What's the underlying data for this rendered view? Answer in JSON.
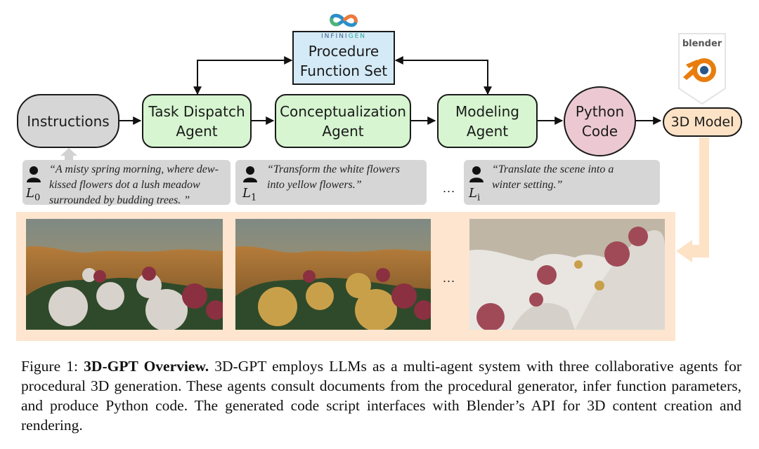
{
  "figure": {
    "logos": {
      "infinigen": {
        "label": "INFINIGEN",
        "label_highlight": "GEN",
        "label_main": "INFINI"
      },
      "blender": {
        "label": "blender"
      }
    },
    "nodes": {
      "procedure_function_set": {
        "line1": "Procedure",
        "line2": "Function Set"
      },
      "instructions": {
        "label": "Instructions"
      },
      "task_dispatch_agent": {
        "line1": "Task Dispatch",
        "line2": "Agent"
      },
      "conceptualization_agent": {
        "line1": "Conceptualization",
        "line2": "Agent"
      },
      "modeling_agent": {
        "line1": "Modeling",
        "line2": "Agent"
      },
      "python_code": {
        "line1": "Python",
        "line2": "Code"
      },
      "model_3d": {
        "label": "3D Model"
      }
    },
    "instructions": [
      {
        "var": "L",
        "sub": "0",
        "text": "“A misty spring morning, where dew-kissed flowers dot a lush meadow surrounded by budding trees. ”",
        "lines": [
          "“A misty spring morning, where dew-",
          "kissed flowers dot a lush meadow",
          "surrounded by budding trees. ”"
        ]
      },
      {
        "var": "L",
        "sub": "1",
        "text": "“Transform the white flowers into yellow flowers.”",
        "lines": [
          "“Transform the white flowers",
          "into yellow flowers.”"
        ]
      },
      {
        "var": "L",
        "sub": "i",
        "text": "“Translate the scene into a winter setting.”",
        "lines": [
          "“Translate the scene into a",
          "winter setting.”"
        ]
      }
    ],
    "ellipsis_instructions": "...",
    "ellipsis_renders": "...",
    "renders": [
      {
        "name": "spring-meadow-white-flowers"
      },
      {
        "name": "spring-meadow-yellow-flowers"
      },
      {
        "name": "winter-scene"
      }
    ],
    "colors": {
      "agent_fill": "#d6f5d0",
      "instructions_fill": "#d6d6d6",
      "procedure_fill": "#d4eaf7",
      "python_fill": "#ecc9d2",
      "model_fill": "#fde2c5",
      "render_panel": "#fde5cf",
      "blender_orange": "#e87d0d",
      "blender_blue": "#265787"
    }
  },
  "caption": {
    "prefix": "Figure 1: ",
    "title": "3D-GPT Overview.",
    "body": " 3D-GPT employs LLMs as a multi-agent system with three collaborative agents for procedural 3D generation. These agents consult documents from the procedural generator, infer function parameters, and produce Python code. The generated code script interfaces with Blender’s API for 3D content creation and rendering."
  }
}
